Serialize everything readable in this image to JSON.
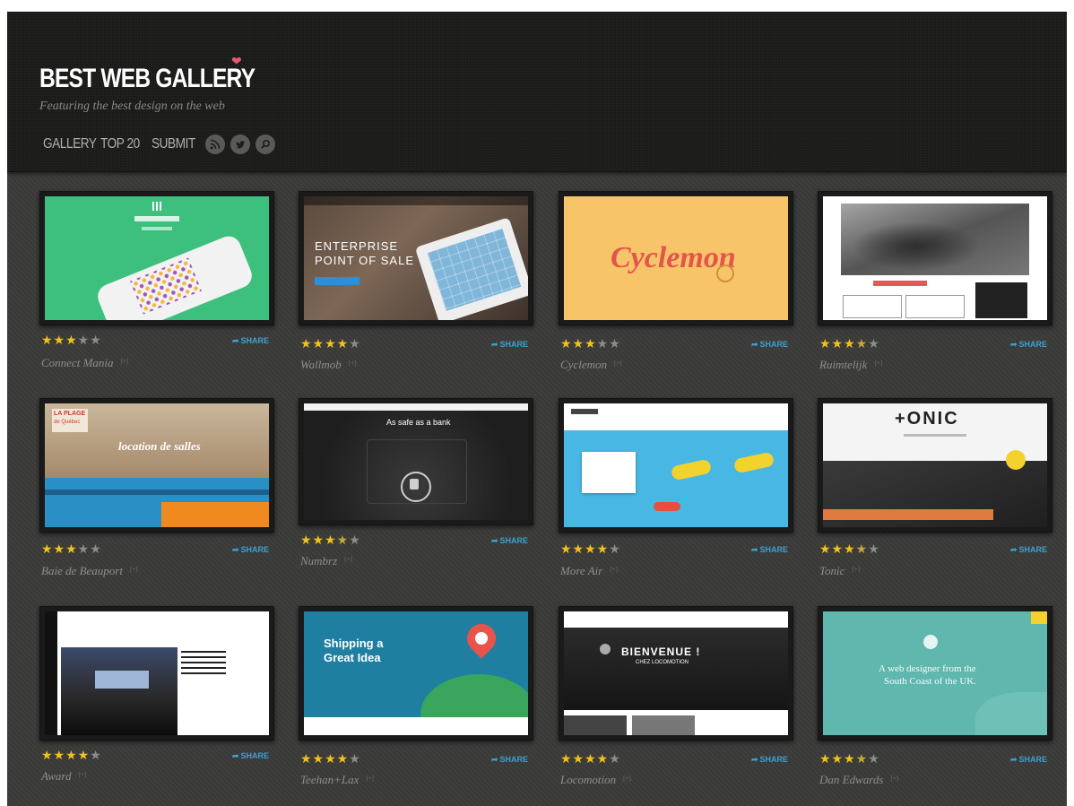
{
  "site": {
    "title": "BEST WEB GALLERY",
    "tagline": "Featuring the best design on the web"
  },
  "nav": {
    "links": [
      "GALLERY",
      "TOP 20",
      "SUBMIT"
    ],
    "icons": [
      "rss-icon",
      "twitter-icon",
      "search-icon"
    ]
  },
  "share_label": "SHARE",
  "plus_label": "[+]",
  "cards": [
    {
      "name": "Connect Mania",
      "rating": 3
    },
    {
      "name": "Wallmob",
      "rating": 4
    },
    {
      "name": "Cyclemon",
      "rating": 3
    },
    {
      "name": "Ruimtelijk",
      "rating": 3.5
    },
    {
      "name": "Baie de Beauport",
      "rating": 3
    },
    {
      "name": "Numbrz",
      "rating": 3.5
    },
    {
      "name": "More Air",
      "rating": 4
    },
    {
      "name": "Tonic",
      "rating": 3.5
    },
    {
      "name": "Award",
      "rating": 4
    },
    {
      "name": "Teehan+Lax",
      "rating": 4
    },
    {
      "name": "Locomotion",
      "rating": 4
    },
    {
      "name": "Dan Edwards",
      "rating": 3.5
    }
  ],
  "screenshots": {
    "wallmob": {
      "headline1": "ENTERPRISE",
      "headline2": "POINT OF SALE"
    },
    "cyclemon": {
      "logo": "Cyclemon"
    },
    "baie": {
      "badge1": "LA PLAGE",
      "badge2": "de Québec",
      "heading": "location de salles"
    },
    "numbrz": {
      "heading": "As safe as a bank"
    },
    "tonic": {
      "logo": "+ONIC"
    },
    "teehan": {
      "heading1": "Shipping a",
      "heading2": "Great Idea"
    },
    "locomotion": {
      "heading": "BIENVENUE !",
      "sub": "CHEZ LOCOMOTION"
    },
    "dan": {
      "line1": "A web designer from the",
      "line2": "South Coast of the UK."
    }
  },
  "colors": {
    "star_on": "#f2c21b",
    "star_off": "#8c8c8a",
    "share": "#3aa2d1",
    "accent": "#e8567a"
  }
}
